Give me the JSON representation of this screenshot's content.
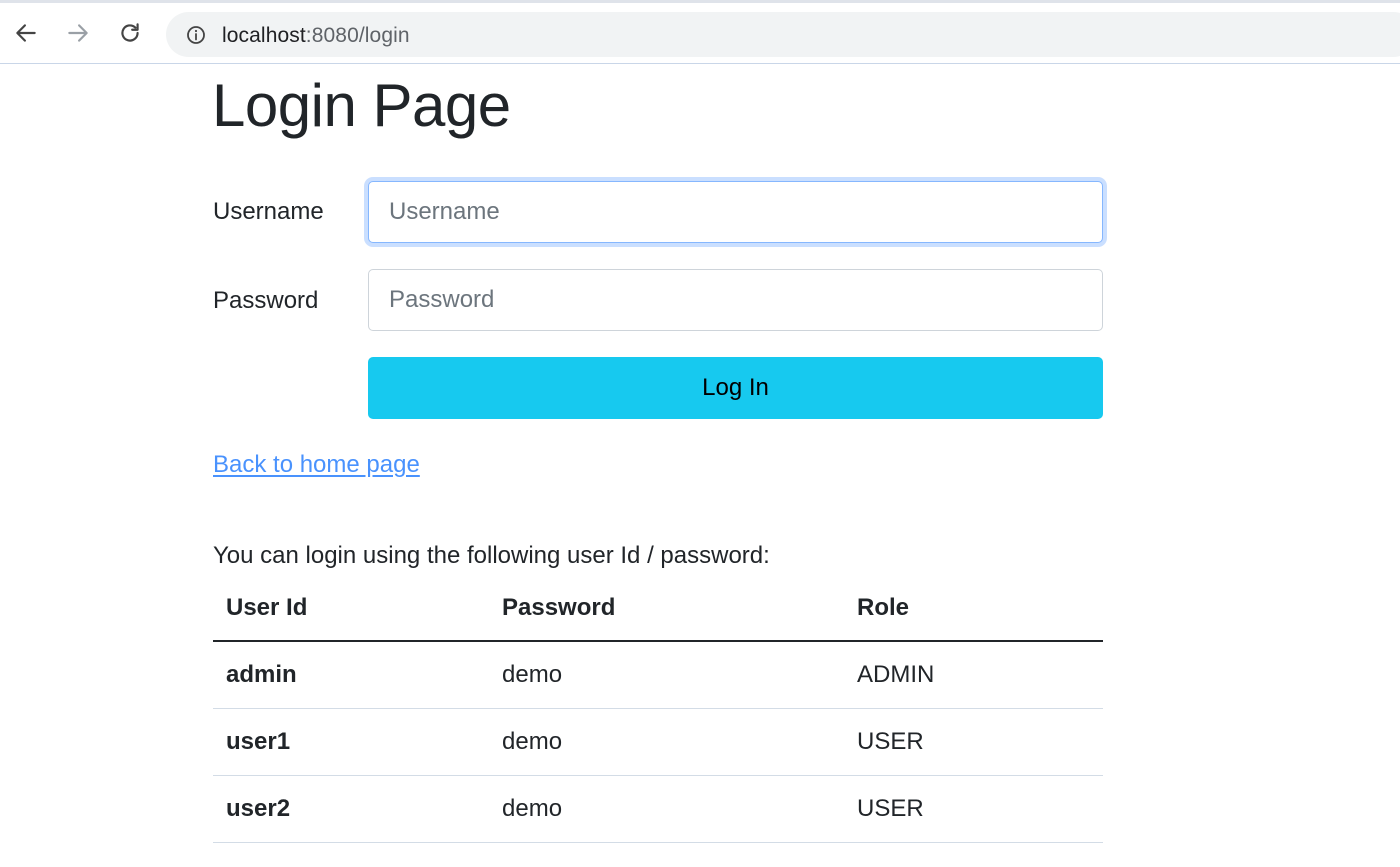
{
  "browser": {
    "url_host": "localhost",
    "url_rest": ":8080/login",
    "icons": {
      "back": "arrow-left-icon",
      "forward": "arrow-right-icon",
      "reload": "reload-icon",
      "info": "info-icon"
    }
  },
  "page": {
    "title": "Login Page",
    "form": {
      "username_label": "Username",
      "username_placeholder": "Username",
      "username_value": "",
      "password_label": "Password",
      "password_placeholder": "Password",
      "password_value": "",
      "submit_label": "Log In"
    },
    "home_link": "Back to home page",
    "info_text": "You can login using the following user Id / password:",
    "table": {
      "headers": [
        "User Id",
        "Password",
        "Role"
      ],
      "rows": [
        [
          "admin",
          "demo",
          "ADMIN"
        ],
        [
          "user1",
          "demo",
          "USER"
        ],
        [
          "user2",
          "demo",
          "USER"
        ]
      ]
    }
  },
  "colors": {
    "button": "#17c9ef",
    "link": "#0d6efd",
    "focus_ring": "#86b7fe"
  }
}
